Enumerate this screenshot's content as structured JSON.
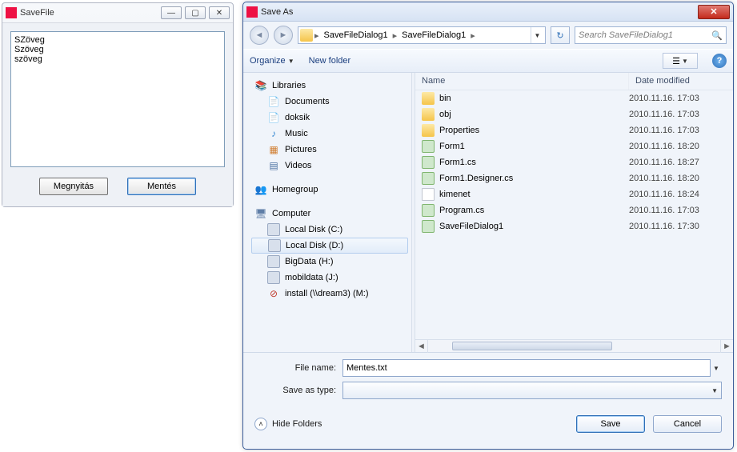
{
  "parent": {
    "title": "SaveFile",
    "text": "SZöveg\nSzöveg\nszöveg",
    "open_label": "Megnyitás",
    "save_label": "Mentés"
  },
  "saveas": {
    "title": "Save As",
    "breadcrumb": [
      "SaveFileDialog1",
      "SaveFileDialog1"
    ],
    "search_placeholder": "Search SaveFileDialog1",
    "toolbar": {
      "organize": "Organize",
      "new_folder": "New folder"
    },
    "tree": {
      "libraries": {
        "label": "Libraries",
        "items": [
          "Documents",
          "doksik",
          "Music",
          "Pictures",
          "Videos"
        ]
      },
      "homegroup": {
        "label": "Homegroup"
      },
      "computer": {
        "label": "Computer",
        "items": [
          "Local Disk (C:)",
          "Local Disk (D:)",
          "BigData (H:)",
          "mobildata (J:)",
          "install (\\\\dream3) (M:)"
        ]
      }
    },
    "columns": {
      "name": "Name",
      "date": "Date modified"
    },
    "files": [
      {
        "name": "bin",
        "kind": "folder",
        "date": "2010.11.16. 17:03"
      },
      {
        "name": "obj",
        "kind": "folder",
        "date": "2010.11.16. 17:03"
      },
      {
        "name": "Properties",
        "kind": "folder",
        "date": "2010.11.16. 17:03"
      },
      {
        "name": "Form1",
        "kind": "cs",
        "date": "2010.11.16. 18:20"
      },
      {
        "name": "Form1.cs",
        "kind": "cs",
        "date": "2010.11.16. 18:27"
      },
      {
        "name": "Form1.Designer.cs",
        "kind": "cs",
        "date": "2010.11.16. 18:20"
      },
      {
        "name": "kimenet",
        "kind": "txt",
        "date": "2010.11.16. 18:24"
      },
      {
        "name": "Program.cs",
        "kind": "cs",
        "date": "2010.11.16. 17:03"
      },
      {
        "name": "SaveFileDialog1",
        "kind": "cs",
        "date": "2010.11.16. 17:30"
      }
    ],
    "filename_label": "File name:",
    "filename_value": "Mentes.txt",
    "type_label": "Save as type:",
    "hide_folders": "Hide Folders",
    "save_btn": "Save",
    "cancel_btn": "Cancel"
  }
}
